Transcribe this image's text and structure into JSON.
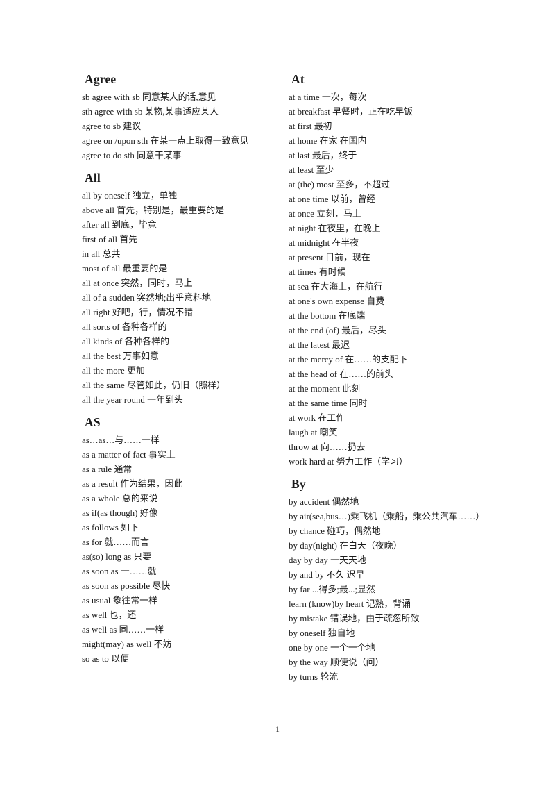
{
  "document": {
    "page_number": "1",
    "columns": [
      {
        "side": "left",
        "sections": [
          {
            "heading": "Agree",
            "entries": [
              "sb agree with sb  同意某人的话,意见",
              "sth agree with sb  某物,某事适应某人",
              "agree to sb  建议",
              "agree  on  /upon  sth  在某一点上取得一致意见",
              "agree to do sth  同意干某事"
            ]
          },
          {
            "heading": "All",
            "entries": [
              "all by oneself 独立，单独",
              "above all  首先，特别是，最重要的是",
              "after all  到底，毕竟",
              "first of all  首先",
              "in all  总共",
              "most of all 最重要的是",
              "all at once  突然，同时，马上",
              "all of a sudden  突然地;出乎意料地",
              "all right  好吧，行，情况不错",
              "all sorts of  各种各样的",
              "all kinds of  各种各样的",
              "all the best  万事如意",
              "all the more  更加",
              "all the same  尽管如此，仍旧（照样）",
              "all the year round  一年到头"
            ]
          },
          {
            "heading": "AS",
            "entries": [
              "as…as…与……一样",
              "as a matter of fact  事实上",
              "as a rule  通常",
              "as a result 作为结果，因此",
              "as a whole  总的来说",
              "as if(as though)  好像",
              "as follows  如下",
              "as for  就……而言",
              "as(so) long as  只要",
              "as soon as  一……就",
              "as soon as possible  尽快",
              "as usual  象往常一样",
              "as well  也，还",
              "as well as  同……一样",
              "might(may) as well  不妨",
              "so as to  以便"
            ]
          }
        ]
      },
      {
        "side": "right",
        "sections": [
          {
            "heading": "At",
            "entries": [
              "at a time  一次，每次",
              "at breakfast  早餐时，正在吃早饭",
              "at first  最初",
              "at home  在家  在国内",
              "at last 最后，终于",
              "at least  至少",
              "at (the) most 至多，不超过",
              "at one time 以前，曾经",
              "at once  立刻，马上",
              "at night  在夜里，在晚上",
              "at midnight  在半夜",
              "at present  目前，现在",
              "at times 有时候",
              "at sea 在大海上，在航行",
              "at one's own expense  自费",
              "at the bottom  在底端",
              "at the end (of)  最后，尽头",
              "at the latest  最迟",
              "at the mercy of  在……的支配下",
              "at the head of  在……的前头",
              "at the moment  此刻",
              "at the same time  同时",
              "at work  在工作",
              "laugh at  嘲笑",
              "throw at 向……扔去",
              "work hard at  努力工作（学习）"
            ]
          },
          {
            "heading": "By",
            "entries": [
              "by accident 偶然地",
              "by     air(sea,bus…)乘飞机（乘船，乘公共汽车……）",
              "by chance  碰巧，偶然地",
              "by day(night)  在白天（夜晚）",
              "day by day  一天天地",
              "by and by  不久  迟早",
              "by far ...得多;最...;显然",
              "learn (know)by heart  记熟，背诵",
              "by mistake  错误地，由于疏忽所致",
              "by oneself  独自地",
              "one by one  一个一个地",
              "by the way  顺便说（问）",
              "by turns  轮流"
            ]
          }
        ]
      }
    ]
  }
}
